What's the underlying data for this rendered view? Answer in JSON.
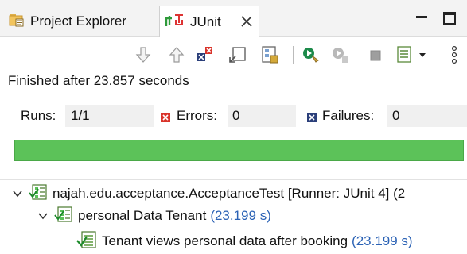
{
  "tabs": {
    "project_explorer": "Project Explorer",
    "junit": "JUnit"
  },
  "status": {
    "finished": "Finished after 23.857 seconds"
  },
  "counters": {
    "runs_label": "Runs:",
    "runs_value": "1/1",
    "errors_label": "Errors:",
    "errors_value": "0",
    "failures_label": "Failures:",
    "failures_value": "0"
  },
  "progress": {
    "fraction": 1.0,
    "color": "#5cc259"
  },
  "tree": {
    "root": {
      "label": "najah.edu.acceptance.AcceptanceTest [Runner: JUnit 4] (2"
    },
    "suite": {
      "label": "personal Data Tenant",
      "time": "(23.199 s)"
    },
    "test": {
      "label": "Tenant views personal data after booking",
      "time": "(23.199 s)"
    }
  },
  "colors": {
    "success_green": "#5cc259",
    "time_blue": "#2b62b5",
    "error_red": "#d9342b",
    "failure_navy": "#2b3f7a"
  }
}
